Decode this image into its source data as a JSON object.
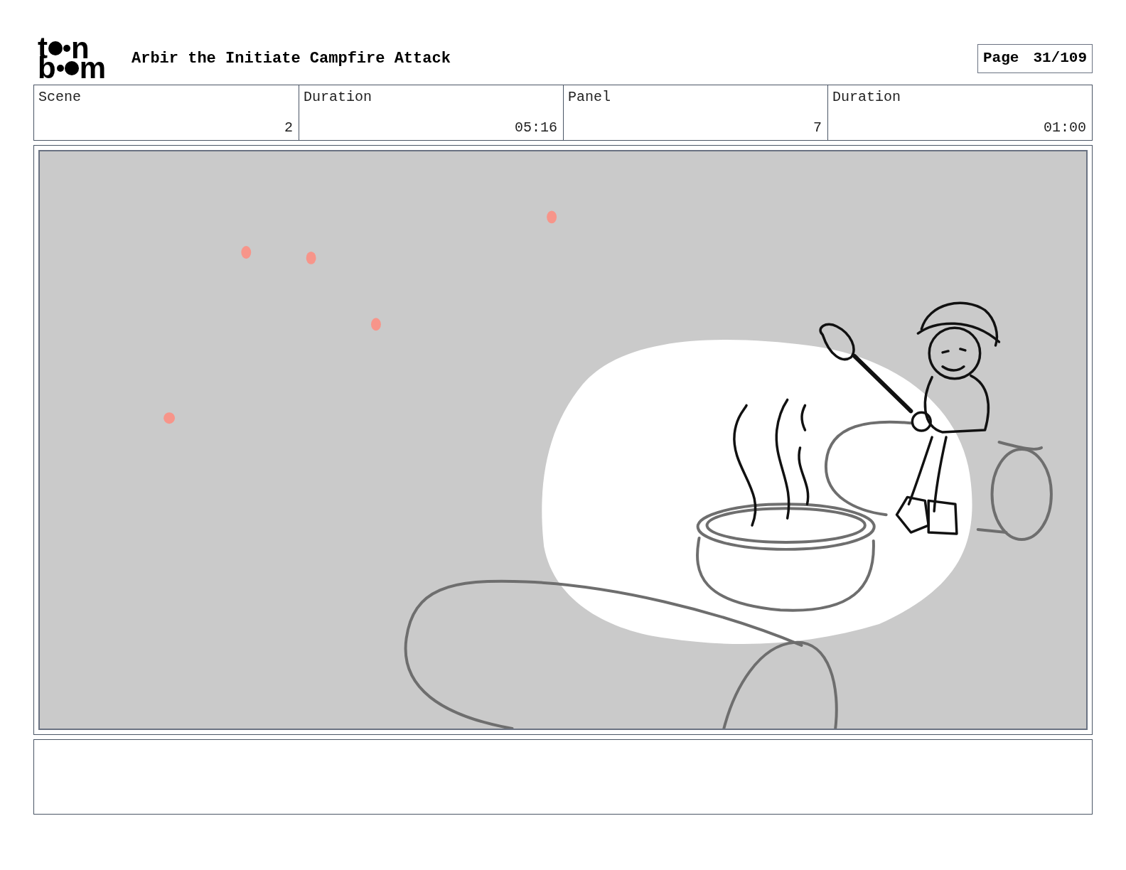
{
  "logo": {
    "top": [
      "t",
      "n"
    ],
    "bottom": [
      "b",
      "m"
    ]
  },
  "title": "Arbir the Initiate Campfire Attack",
  "page": {
    "label": "Page",
    "value": "31/109"
  },
  "info_table": {
    "columns": [
      "Scene",
      "Duration",
      "Panel",
      "Duration"
    ],
    "rows": [
      [
        "2",
        "05:16",
        "7",
        "01:00"
      ]
    ]
  }
}
